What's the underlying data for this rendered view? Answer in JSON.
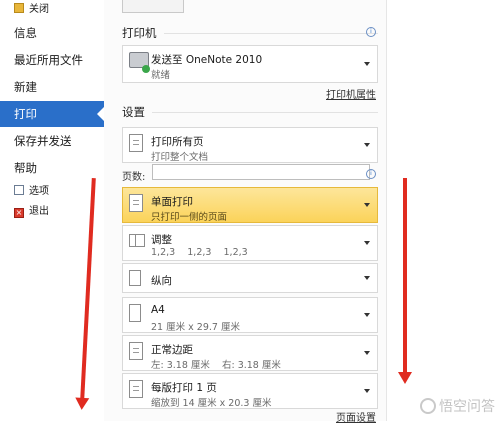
{
  "nav": {
    "items": [
      {
        "label": "关闭"
      },
      {
        "label": "信息"
      },
      {
        "label": "最近所用文件"
      },
      {
        "label": "新建"
      },
      {
        "label": "打印"
      },
      {
        "label": "保存并发送"
      },
      {
        "label": "帮助"
      },
      {
        "label": "选项"
      },
      {
        "label": "退出"
      }
    ],
    "active_color": "#2a6fc9"
  },
  "printer": {
    "title": "打印机",
    "name": "发送至 OneNote 2010",
    "status": "就绪",
    "properties_link": "打印机属性"
  },
  "settings": {
    "title": "设置",
    "print_all": {
      "main": "打印所有页",
      "sub": "打印整个文档"
    },
    "pages_label": "页数:",
    "pages_value": "",
    "sides": {
      "main": "单面打印",
      "sub": "只打印一侧的页面"
    },
    "collate": {
      "main": "调整",
      "sub": "1,2,3    1,2,3    1,2,3"
    },
    "orientation": {
      "main": "纵向"
    },
    "paper": {
      "main": "A4",
      "sub": "21 厘米 x 29.7 厘米"
    },
    "margins": {
      "main": "正常边距",
      "sub": "左: 3.18 厘米    右: 3.18 厘米"
    },
    "per_sheet": {
      "main": "每版打印 1 页",
      "sub": "缩放到 14 厘米 x 20.3 厘米"
    },
    "page_setup_link": "页面设置",
    "highlight_color": "#fbd35a"
  },
  "watermark": {
    "text": "悟空问答"
  },
  "annotation_color": "#e02b20"
}
